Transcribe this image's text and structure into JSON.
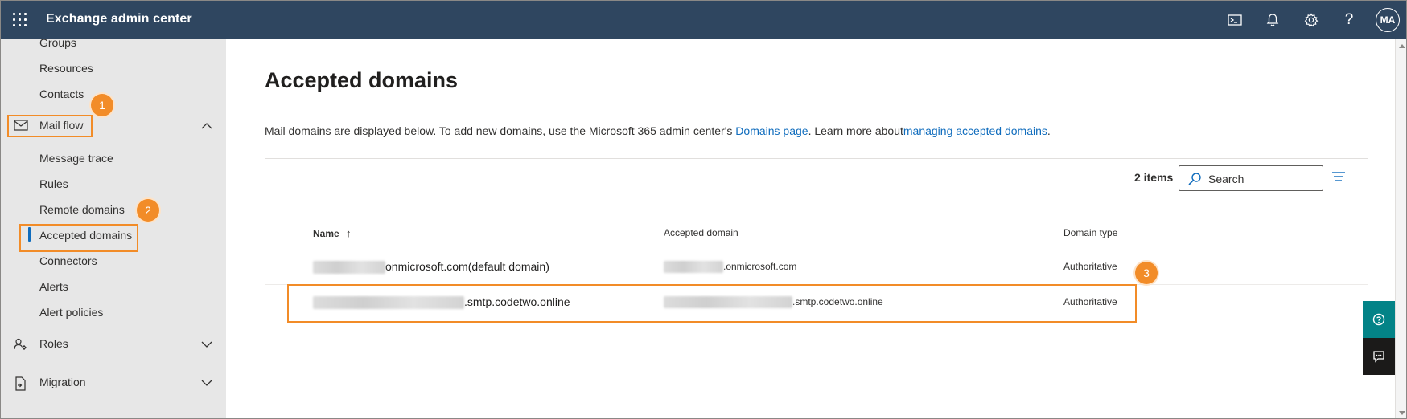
{
  "header": {
    "app_title": "Exchange admin center",
    "avatar_initials": "MA",
    "icons": [
      "app-launcher-icon",
      "cloud-shell-icon",
      "notifications-icon",
      "settings-icon",
      "help-icon"
    ]
  },
  "sidebar": {
    "items_top": [
      {
        "label": "Groups"
      },
      {
        "label": "Resources"
      },
      {
        "label": "Contacts"
      }
    ],
    "mail_flow": {
      "label": "Mail flow",
      "expanded": true,
      "children": [
        {
          "label": "Message trace"
        },
        {
          "label": "Rules"
        },
        {
          "label": "Remote domains"
        },
        {
          "label": "Accepted domains",
          "active": true
        },
        {
          "label": "Connectors"
        },
        {
          "label": "Alerts"
        },
        {
          "label": "Alert policies"
        }
      ]
    },
    "roles": {
      "label": "Roles",
      "expanded": false
    },
    "migration": {
      "label": "Migration",
      "expanded": false
    }
  },
  "main": {
    "page_title": "Accepted domains",
    "description": {
      "prefix": "Mail domains are displayed below. To add new domains, use the Microsoft 365 admin center's ",
      "link1": "Domains page",
      "middle": ". Learn more about",
      "link2": "managing accepted domains",
      "suffix": "."
    },
    "items_count": "2 items",
    "search": {
      "placeholder": "Search"
    },
    "table": {
      "columns": [
        "Name",
        "Accepted domain",
        "Domain type"
      ],
      "sort_indicator": "↑",
      "rows": [
        {
          "name_suffix": "onmicrosoft.com(default domain)",
          "accepted_suffix": ".onmicrosoft.com",
          "domain_type": "Authoritative"
        },
        {
          "name_suffix": ".smtp.codetwo.online",
          "accepted_suffix": ".smtp.codetwo.online",
          "domain_type": "Authoritative"
        }
      ]
    }
  },
  "callouts": {
    "badge1": "1",
    "badge2": "2",
    "badge3": "3",
    "color": "#f28c28"
  },
  "colors": {
    "header_bg": "#2f4660",
    "sidebar_bg": "#e7e7e7",
    "link": "#0f6cbd",
    "help_button": "#038387"
  }
}
